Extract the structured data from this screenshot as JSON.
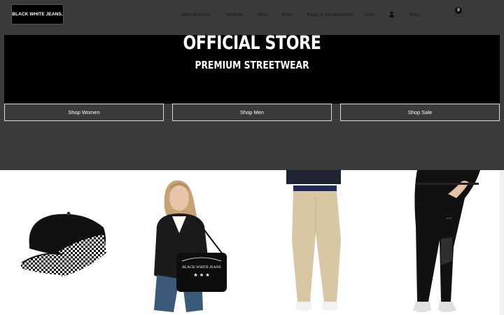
{
  "header": {
    "logo_text": "BLACK WHITE JEANS.",
    "nav": [
      {
        "label": "New Arrivals"
      },
      {
        "label": "Women"
      },
      {
        "label": "Men"
      },
      {
        "label": "Kids"
      },
      {
        "label": "Bags & Accessories"
      },
      {
        "label": "Sale"
      },
      {
        "label": "Blog"
      }
    ],
    "cart_count": "0"
  },
  "hero": {
    "title": "OFFICIAL STORE",
    "subtitle": "PREMIUM STREETWEAR",
    "buttons": [
      {
        "label": "Shop Women"
      },
      {
        "label": "Shop Men"
      },
      {
        "label": "Shop Sale"
      }
    ]
  },
  "products": {
    "items": [
      {
        "image": "checkered-cap"
      },
      {
        "image": "model-with-bag"
      },
      {
        "image": "beige-chinos"
      },
      {
        "image": "black-leggings"
      }
    ],
    "bag_print": "BLACK WHITE JEANS"
  },
  "colors": {
    "header_bg": "#3a3a3a",
    "hero_black": "#000000",
    "text_dark": "#1a1a1a",
    "white": "#ffffff"
  }
}
